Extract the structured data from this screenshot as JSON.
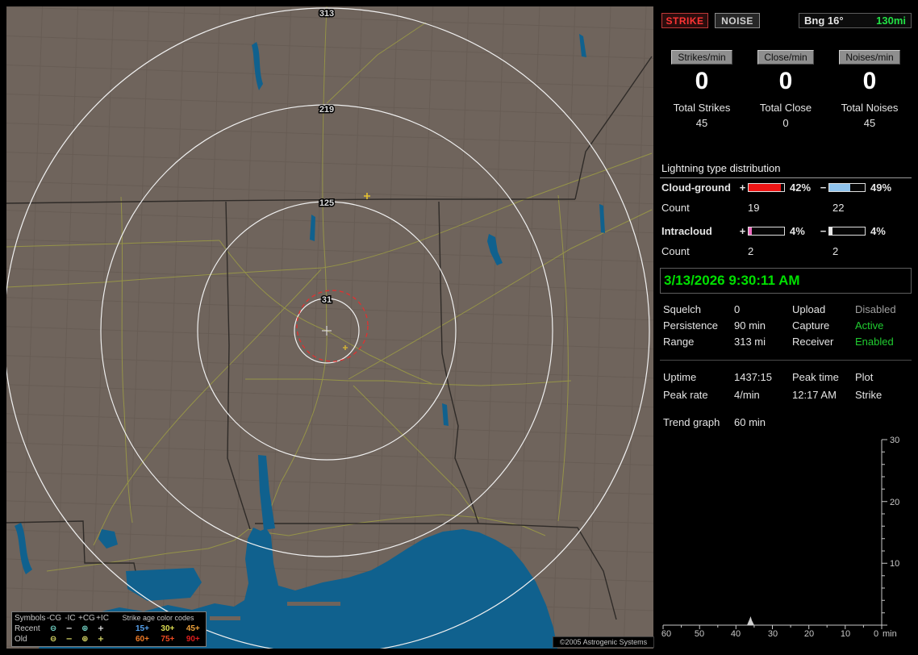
{
  "header": {
    "strike_button": "STRIKE",
    "noise_button": "NOISE",
    "bearing": "Bng 16°",
    "range": "130mi",
    "range_color": "#22e045"
  },
  "rates": {
    "columns": [
      {
        "button": "Strikes/min",
        "rate": "0",
        "total_label": "Total Strikes",
        "total_value": "45"
      },
      {
        "button": "Close/min",
        "rate": "0",
        "total_label": "Total Close",
        "total_value": "0"
      },
      {
        "button": "Noises/min",
        "rate": "0",
        "total_label": "Total Noises",
        "total_value": "45"
      }
    ]
  },
  "distribution": {
    "title": "Lightning type distribution",
    "rows": [
      {
        "label": "Cloud-ground",
        "plus_sign": "+",
        "minus_sign": "−",
        "plus_pct": "42%",
        "plus_fill": "90%",
        "plus_color": "#ee1515",
        "minus_pct": "49%",
        "minus_fill": "58%",
        "minus_color": "#8fc3ec",
        "count_label": "Count",
        "plus_count": "19",
        "minus_count": "22"
      },
      {
        "label": "Intracloud",
        "plus_sign": "+",
        "minus_sign": "−",
        "plus_pct": "4%",
        "plus_fill": "10%",
        "plus_color": "#ef6cc0",
        "minus_pct": "4%",
        "minus_fill": "8%",
        "minus_color": "#e8e8e8",
        "count_label": "Count",
        "plus_count": "2",
        "minus_count": "2"
      }
    ]
  },
  "clock": {
    "datetime": "3/13/2026 9:30:11 AM",
    "color": "#00e000"
  },
  "settings": [
    {
      "label1": "Squelch",
      "value1": "0",
      "label2": "Upload",
      "value2": "Disabled",
      "value2_color": "#a0a0a0"
    },
    {
      "label1": "Persistence",
      "value1": "90 min",
      "label2": "Capture",
      "value2": "Active",
      "value2_color": "#20cc30"
    },
    {
      "label1": "Range",
      "value1": "313 mi",
      "label2": "Receiver",
      "value2": "Enabled",
      "value2_color": "#20cc30"
    }
  ],
  "session": [
    {
      "c1": "Uptime",
      "c2": "1437:15",
      "c3": "Peak time",
      "c4": "Plot"
    },
    {
      "c1": "Peak rate",
      "c2": "4/min",
      "c3": "12:17 AM",
      "c4": "Strike"
    }
  ],
  "trend": {
    "label": "Trend graph",
    "value": "60 min"
  },
  "chart_data": {
    "type": "area",
    "title": "Strike rate trend (last 60 minutes)",
    "x_unit": "min",
    "x_ticks": [
      "60",
      "50",
      "40",
      "30",
      "20",
      "10",
      "0"
    ],
    "y_ticks": [
      "30",
      "20",
      "10"
    ],
    "ylim": [
      0,
      30
    ],
    "xlim_minutes_ago": [
      60,
      0
    ],
    "axis_side": "right",
    "grid": false,
    "series": [
      {
        "name": "Strikes/min",
        "x_min_ago": [
          60,
          38,
          36,
          35,
          34,
          0
        ],
        "values": [
          0,
          0,
          2,
          2,
          0,
          0
        ]
      }
    ]
  },
  "map": {
    "rings": [
      {
        "label": "313"
      },
      {
        "label": "219"
      },
      {
        "label": "125"
      },
      {
        "label": "31"
      }
    ],
    "copyright": "©2005 Astrogenic Systems",
    "legend": {
      "symbols_label": "Symbols",
      "col_headers": [
        "-CG",
        "-IC",
        "+CG",
        "+IC"
      ],
      "age_title": "Strike age color codes",
      "rows": [
        {
          "label": "Recent",
          "symbols": [
            "⊖",
            "−",
            "⊕",
            "+"
          ],
          "symbol_colors": [
            "#74d6c9",
            "#e6e6e6",
            "#74d6c9",
            "#e6e6e6"
          ],
          "ages": [
            {
              "label": "15+",
              "color": "#56a2ee"
            },
            {
              "label": "30+",
              "color": "#dede52"
            },
            {
              "label": "45+",
              "color": "#eda03a"
            }
          ]
        },
        {
          "label": "Old",
          "symbols": [
            "⊖",
            "−",
            "⊕",
            "+"
          ],
          "symbol_colors": [
            "#dede6a",
            "#dede6a",
            "#dede6a",
            "#dede6a"
          ],
          "ages": [
            {
              "label": "60+",
              "color": "#ee7a26"
            },
            {
              "label": "75+",
              "color": "#ee4a20"
            },
            {
              "label": "90+",
              "color": "#dd1d1d"
            }
          ]
        }
      ]
    }
  }
}
